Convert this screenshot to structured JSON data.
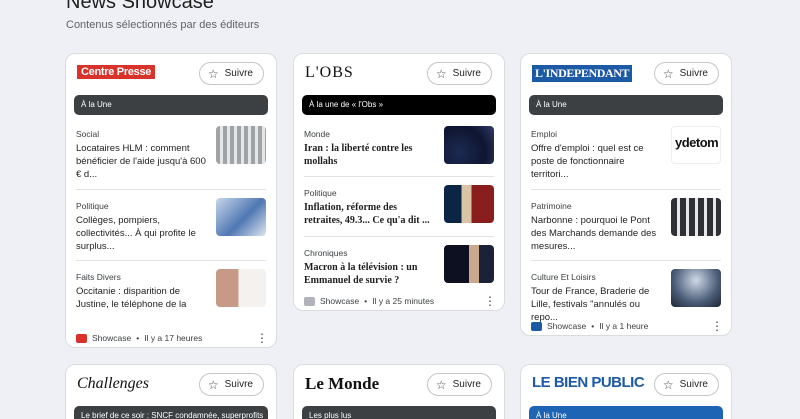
{
  "header": {
    "title": "News Showcase",
    "subtitle": "Contenus sélectionnés par des éditeurs"
  },
  "follow_label": "Suivre",
  "cards": [
    {
      "logo": "Centre Presse",
      "banner": "À la Une",
      "stories": [
        {
          "category": "Social",
          "title": "Locataires HLM : comment bénéficier de l'aide jusqu'à 600 € d..."
        },
        {
          "category": "Politique",
          "title": "Collèges, pompiers, collectivités... À qui profite le surplus..."
        },
        {
          "category": "Faits Divers",
          "title": "Occitanie : disparition de Justine, le téléphone de la"
        }
      ],
      "footer": {
        "source": "Showcase",
        "time": "Il y a 17 heures"
      }
    },
    {
      "logo": "L'OBS",
      "banner": "À la une de « l'Obs »",
      "stories": [
        {
          "category": "Monde",
          "title": "Iran : la liberté contre les mollahs"
        },
        {
          "category": "Politique",
          "title": "Inflation, réforme des retraites, 49.3... Ce qu'a dit ..."
        },
        {
          "category": "Chroniques",
          "title": "Macron à la télévision : un Emmanuel de survie ?"
        }
      ],
      "footer": {
        "source": "Showcase",
        "time": "Il y a 25 minutes"
      }
    },
    {
      "logo": "L'INDEPENDANT",
      "banner": "À la Une",
      "thumb_text": "ydetom",
      "stories": [
        {
          "category": "Emploi",
          "title": "Offre d'emploi : quel est ce poste de fonctionnaire territori..."
        },
        {
          "category": "Patrimoine",
          "title": "Narbonne : pourquoi le Pont des Marchands demande des mesures..."
        },
        {
          "category": "Culture Et Loisirs",
          "title": "Tour de France, Braderie de Lille, festivals \"annulés ou repo..."
        }
      ],
      "footer": {
        "source": "Showcase",
        "time": "Il y a 1 heure"
      }
    },
    {
      "logo": "Challenges",
      "banner": "Le brief de ce soir : SNCF condamnée, superprofits"
    },
    {
      "logo": "Le Monde",
      "banner": "Les plus lus"
    },
    {
      "logo": "LE BIEN PUBLIC",
      "banner": "À la Une"
    }
  ],
  "colors": {
    "background": "#eef0f5",
    "banner_dark": "#3c4043",
    "banner_black": "#000000",
    "banner_blue": "#1e64b4",
    "centre_presse_red": "#d8322a",
    "independant_blue": "#1d5aa6",
    "bien_public_blue": "#1d5aa6"
  }
}
